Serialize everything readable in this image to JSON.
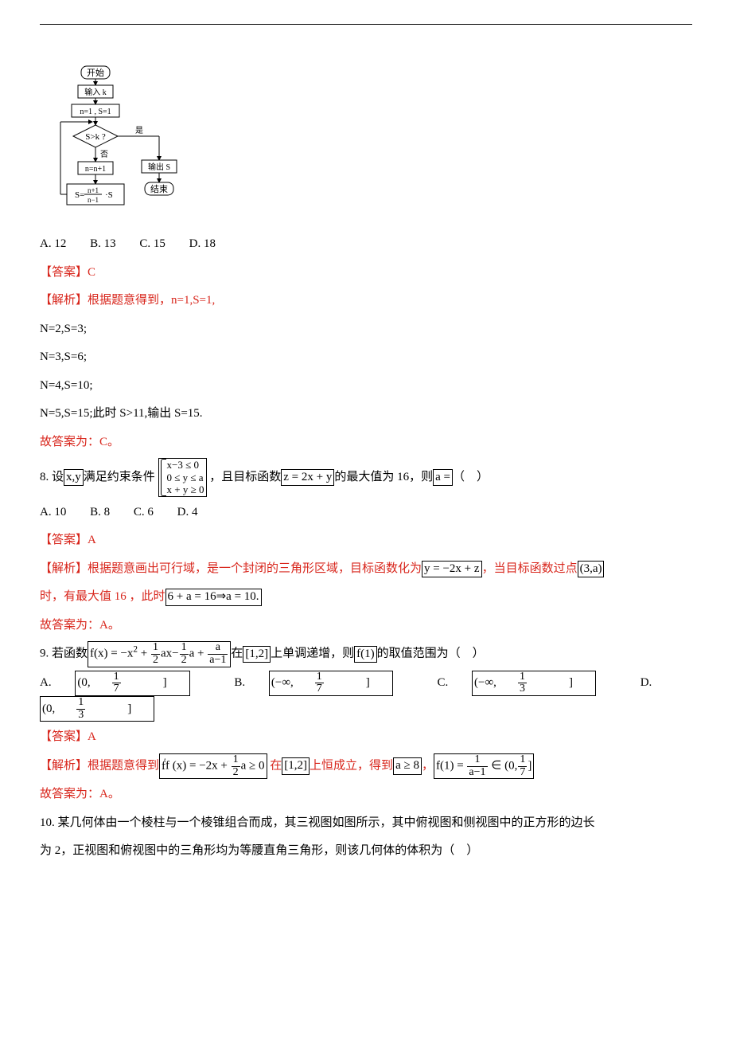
{
  "flowchart": {
    "start": "开始",
    "input": "输入 k",
    "init": "n=1 , S=1",
    "cond": "S>k ?",
    "yes": "是",
    "no": "否",
    "inc": "n=n+1",
    "update_left": "S=",
    "update_num": "n+1",
    "update_den": "n−1",
    "update_right": "·S",
    "output": "输出 S",
    "end": "结束"
  },
  "opts7": {
    "a": "A. 12",
    "b": "B. 13",
    "c": "C. 15",
    "d": "D. 18"
  },
  "ans7_label": "【答案】C",
  "exp7_head": "【解析】根据题意得到，n=1,S=1,",
  "exp7_l1": "N=2,S=3;",
  "exp7_l2": "N=3,S=6;",
  "exp7_l3": "N=4,S=10;",
  "exp7_l4": "N=5,S=15;此时 S>11,输出 S=15.",
  "exp7_end": "故答案为：C。",
  "q8_pre": "8. 设",
  "q8_xy": "x,y",
  "q8_mid1": "满足约束条件",
  "q8_c1": "x−3 ≤ 0",
  "q8_c2": "0 ≤ y ≤ a",
  "q8_c3": "x + y ≥ 0",
  "q8_mid2": "，且目标函数",
  "q8_z": "z = 2x + y",
  "q8_mid3": "的最大值为 16，则",
  "q8_a": "a =",
  "q8_tail": "（　）",
  "opts8": {
    "a": "A. 10",
    "b": "B. 8",
    "c": "C. 6",
    "d": "D. 4"
  },
  "ans8_label": "【答案】A",
  "exp8_1a": "【解析】根据题意画出可行域，是一个封闭的三角形区域，目标函数化为",
  "exp8_eq1": "y = −2x + z",
  "exp8_1b": "，当目标函数过点",
  "exp8_pt": "(3,a)",
  "exp8_2a": "时，有最大值 16 ，此时",
  "exp8_eq2": "6 + a = 16⇒a = 10.",
  "exp8_end": "故答案为：A。",
  "q9_pre": "9. 若函数",
  "q9_fx_left": "f(x) = −x",
  "q9_fx_mid1": " + ",
  "q9_half1_num": "1",
  "q9_half1_den": "2",
  "q9_fx_ax": "ax−",
  "q9_half2_num": "1",
  "q9_half2_den": "2",
  "q9_fx_a": "a + ",
  "q9_frac_a_num": "a",
  "q9_frac_a_den": "a−1",
  "q9_mid1": "在",
  "q9_int": "[1,2]",
  "q9_mid2": "上单调递增，则",
  "q9_f1": "f(1)",
  "q9_tail": "的取值范围为（　）",
  "opts9": {
    "a_pre": "A. ",
    "a_l": "(0,",
    "a_num": "1",
    "a_den": "7",
    "a_r": "]",
    "b_pre": "B. ",
    "b_l": "(−∞,",
    "b_num": "1",
    "b_den": "7",
    "b_r": "]",
    "c_pre": "C. ",
    "c_l": "(−∞,",
    "c_num": "1",
    "c_den": "3",
    "c_r": "]",
    "d_pre": "D. ",
    "d_l": "(0,",
    "d_num": "1",
    "d_den": "3",
    "d_r": "]"
  },
  "ans9_label": "【答案】A",
  "exp9_a": "【解析】根据题意得到",
  "exp9_fpx_l": "f (x) = −2x + ",
  "exp9_fpx_num": "1",
  "exp9_fpx_den": "2",
  "exp9_fpx_r": "a ≥ 0",
  "exp9_b": " 在",
  "exp9_int": "[1,2]",
  "exp9_c": "上恒成立，得到",
  "exp9_a8": "a ≥ 8",
  "exp9_d": "，",
  "exp9_f1_l": "f(1) = ",
  "exp9_f1_num": "1",
  "exp9_f1_den": "a−1",
  "exp9_f1_mid": " ∈ (0,",
  "exp9_f1_num2": "1",
  "exp9_f1_den2": "7",
  "exp9_f1_r": "]",
  "exp9_end": "故答案为：A。",
  "q10_l1": "10. 某几何体由一个棱柱与一个棱锥组合而成，其三视图如图所示，其中俯视图和侧视图中的正方形的边长",
  "q10_l2": "为 2，正视图和俯视图中的三角形均为等腰直角三角形，则该几何体的体积为（　）"
}
